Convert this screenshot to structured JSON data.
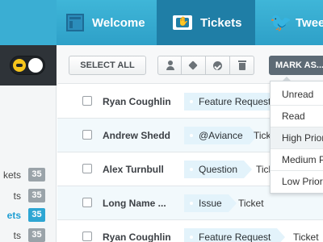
{
  "nav": {
    "tabs": [
      {
        "label": "Welcome",
        "icon": "welcome-icon"
      },
      {
        "label": "Tickets",
        "icon": "ticket-icon",
        "active": true
      },
      {
        "label": "Twee",
        "icon": "twitter-bird-icon"
      }
    ]
  },
  "sidebar": {
    "items": [
      {
        "label": "kets",
        "count": "35"
      },
      {
        "label": "ts",
        "count": "35"
      },
      {
        "label": "ets",
        "count": "35",
        "active": true
      },
      {
        "label": "ts",
        "count": "35"
      }
    ]
  },
  "toolbar": {
    "select_all": "SELECT ALL",
    "mark_as": "MARK AS...",
    "icons": [
      "person-icon",
      "tag-icon",
      "check-icon",
      "trash-icon"
    ]
  },
  "tickets": [
    {
      "name": "Ryan Coughlin",
      "tag": "Feature Request",
      "ticket": ""
    },
    {
      "name": "Andrew Shedd",
      "tag": "@Aviance",
      "ticket": "Ticke"
    },
    {
      "name": "Alex Turnbull",
      "tag": "Question",
      "ticket": "Tick"
    },
    {
      "name": "Long Name ...",
      "tag": "Issue",
      "ticket": "Ticket"
    },
    {
      "name": "Ryan Coughlin",
      "tag": "Feature Request",
      "ticket": "Ticket"
    }
  ],
  "mark_as_menu": [
    "Unread",
    "Read",
    "High Prior",
    "Medium Pri",
    "Low Prior"
  ],
  "colors": {
    "accent": "#2ea6d3",
    "nav_active": "#1f7ea6",
    "tag_bg": "#e3f3fb",
    "dark_panel": "#2e3338"
  }
}
